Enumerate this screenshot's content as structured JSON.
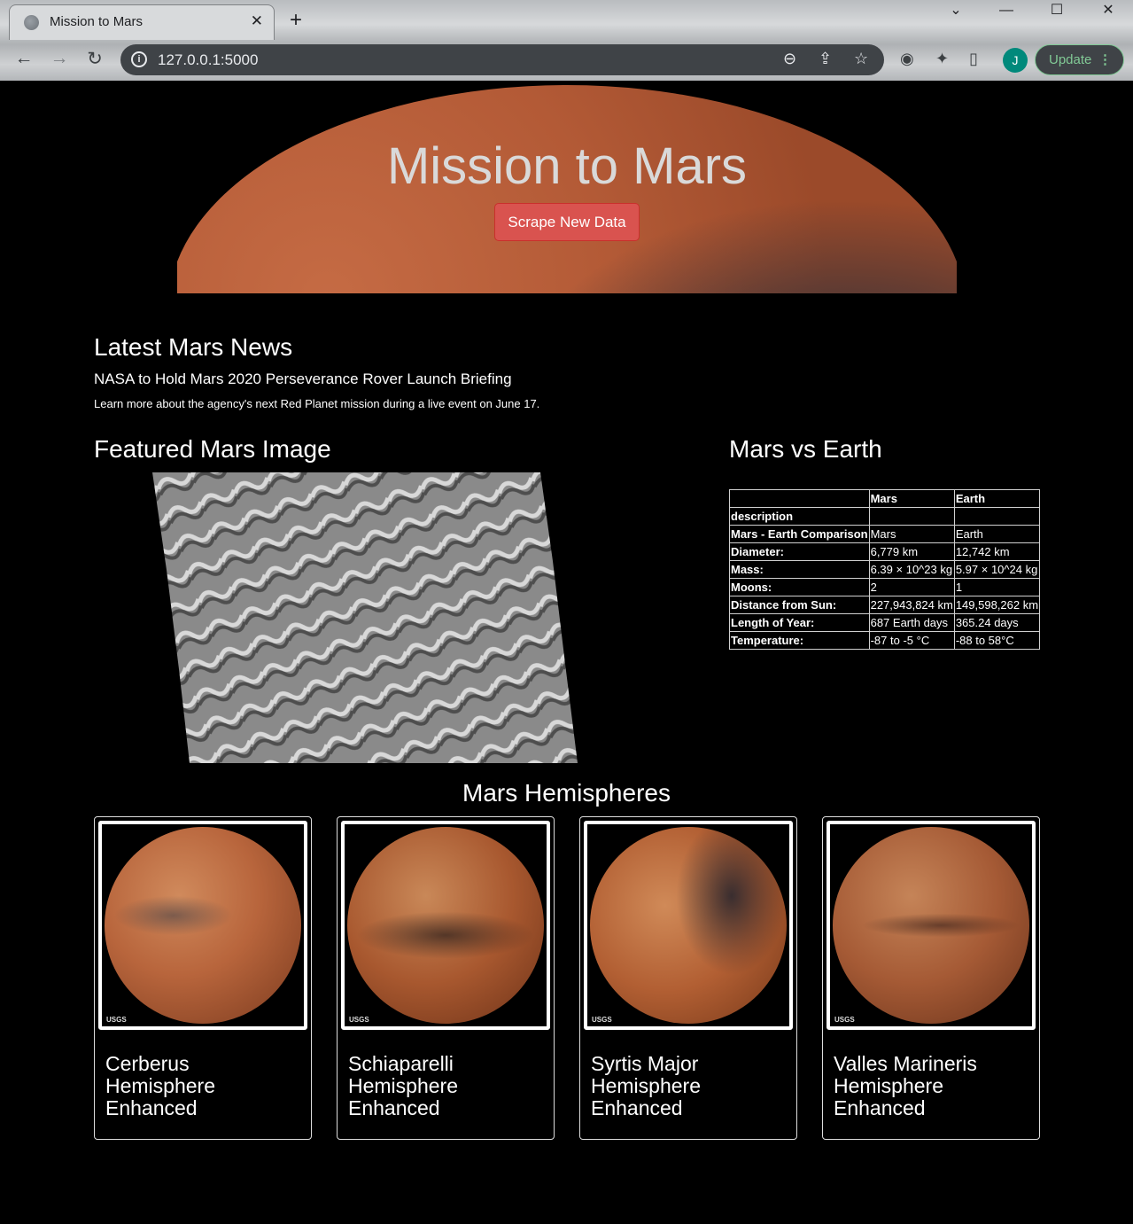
{
  "browser": {
    "tab_title": "Mission to Mars",
    "url": "127.0.0.1:5000",
    "avatar_letter": "J",
    "update_label": "Update"
  },
  "header": {
    "title": "Mission to Mars",
    "scrape_button": "Scrape New Data"
  },
  "news": {
    "heading": "Latest Mars News",
    "title": "NASA to Hold Mars 2020 Perseverance Rover Launch Briefing",
    "paragraph": "Learn more about the agency's next Red Planet mission during a live event on June 17."
  },
  "featured": {
    "heading": "Featured Mars Image"
  },
  "facts": {
    "heading": "Mars vs Earth",
    "columns": [
      "",
      "Mars",
      "Earth"
    ],
    "rows": [
      [
        "description",
        "",
        ""
      ],
      [
        "Mars - Earth Comparison",
        "Mars",
        "Earth"
      ],
      [
        "Diameter:",
        "6,779 km",
        "12,742 km"
      ],
      [
        "Mass:",
        "6.39 × 10^23 kg",
        "5.97 × 10^24 kg"
      ],
      [
        "Moons:",
        "2",
        "1"
      ],
      [
        "Distance from Sun:",
        "227,943,824 km",
        "149,598,262 km"
      ],
      [
        "Length of Year:",
        "687 Earth days",
        "365.24 days"
      ],
      [
        "Temperature:",
        "-87 to -5 °C",
        "-88 to 58°C"
      ]
    ]
  },
  "hemispheres": {
    "heading": "Mars Hemispheres",
    "items": [
      {
        "title": "Cerberus Hemisphere Enhanced"
      },
      {
        "title": "Schiaparelli Hemisphere Enhanced"
      },
      {
        "title": "Syrtis Major Hemisphere Enhanced"
      },
      {
        "title": "Valles Marineris Hemisphere Enhanced"
      }
    ],
    "usgs_label": "USGS"
  }
}
